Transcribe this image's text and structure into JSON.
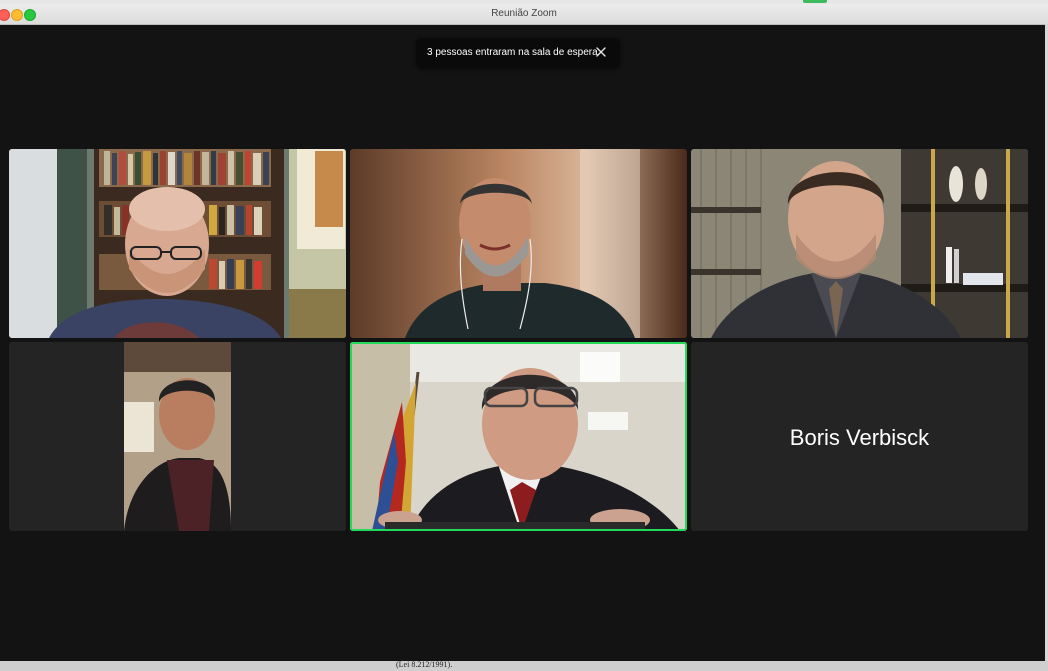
{
  "window": {
    "title": "Reunião Zoom"
  },
  "notification": {
    "message": "3 pessoas entraram na sala de espera",
    "close_icon": "close-icon"
  },
  "participants": [
    {
      "tile": 1,
      "video": true,
      "speaking": false
    },
    {
      "tile": 2,
      "video": true,
      "speaking": false
    },
    {
      "tile": 3,
      "video": true,
      "speaking": false
    },
    {
      "tile": 4,
      "video": true,
      "speaking": false
    },
    {
      "tile": 5,
      "video": true,
      "speaking": true
    },
    {
      "tile": 6,
      "video": false,
      "name": "Boris Verbisck",
      "speaking": false
    }
  ],
  "background_text": "(Lei 8.212/1991).",
  "colors": {
    "active_speaker": "#23d959",
    "background": "#131313",
    "tile": "#242424"
  }
}
